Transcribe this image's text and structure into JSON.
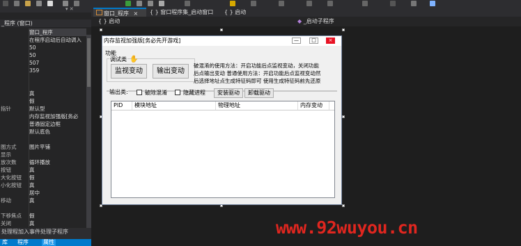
{
  "colors": {
    "accent": "#007acc",
    "watermark": "#e0261f"
  },
  "toolbar": {
    "icons": [
      "arrow-icon",
      "save-icon",
      "open-icon",
      "run-icon",
      "stop-icon",
      "pause-icon",
      "breakpoint-icon",
      "debug-icon",
      "help-icon"
    ]
  },
  "properties": {
    "header": "_程序 (窗口)",
    "rows": [
      {
        "name": "",
        "value": "窗口_程序"
      },
      {
        "name": "",
        "value": "在程序启动后自动调入"
      },
      {
        "name": "",
        "value": "50"
      },
      {
        "name": "",
        "value": "50"
      },
      {
        "name": "",
        "value": "507"
      },
      {
        "name": "",
        "value": "359"
      },
      {
        "name": "",
        "value": ""
      },
      {
        "name": "",
        "value": ""
      },
      {
        "name": "",
        "value": "真"
      },
      {
        "name": "",
        "value": "假"
      },
      {
        "name": "指针",
        "value": "默认型"
      },
      {
        "name": "",
        "value": "内存监视加强版[务必"
      },
      {
        "name": "",
        "value": "普通固定边框"
      },
      {
        "name": "",
        "value": "默认底色"
      },
      {
        "name": "",
        "value": ""
      },
      {
        "name": "图方式",
        "value": "图片平铺"
      },
      {
        "name": "显示",
        "value": ""
      },
      {
        "name": "放次数",
        "value": "循环播放"
      },
      {
        "name": "按钮",
        "value": "真"
      },
      {
        "name": "大化按钮",
        "value": "假"
      },
      {
        "name": "小化按钮",
        "value": "真"
      },
      {
        "name": "",
        "value": "居中"
      },
      {
        "name": "移动",
        "value": "真"
      },
      {
        "name": "",
        "value": ""
      },
      {
        "name": "下移焦点",
        "value": "假"
      },
      {
        "name": "关闭",
        "value": "真"
      }
    ],
    "footer": "处理程加入事件处理子程序",
    "tabs": [
      "库",
      "程序",
      "属性"
    ]
  },
  "doc_tabs": [
    {
      "label": "窗口_程序",
      "active": true,
      "close": "×"
    },
    {
      "label": "{ } 窗口程序集_启动窗口",
      "active": false,
      "close": ""
    },
    {
      "label": "{ } 启动",
      "active": false,
      "close": ""
    }
  ],
  "nav": {
    "left": "{ } 启动",
    "right": "_启动子程序"
  },
  "form": {
    "title": "内存监视加强版[务必先开游戏]",
    "win_buttons": [
      "—",
      "□",
      "×"
    ],
    "func_label": "功能",
    "debug_group": "调试类",
    "monitor_button": "监视变动",
    "output_button": "输出变动",
    "help_lines": [
      "破混淆的使用方法：开启功能后点监视变动，关闭功能",
      "后点输出变动  普通使用方法：开启功能后点监视变动然",
      "后选择地址点生成特征码即可  使用生成特征码前先还原"
    ],
    "output_label": "输出类:",
    "check_hide": "破除混淆",
    "check_process": "隐藏进程",
    "install_button": "安装驱动",
    "uninstall_button": "卸载驱动",
    "columns": [
      "PID",
      "模块地址",
      "物理地址",
      "内存变动"
    ]
  },
  "watermark": "www.92wuyou.cn"
}
